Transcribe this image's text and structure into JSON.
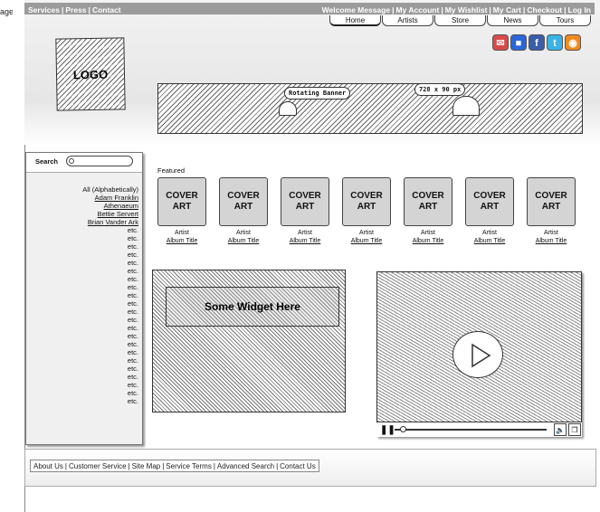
{
  "page_edge_label": "age",
  "top_nav_left": [
    "Services",
    "Press",
    "Contact"
  ],
  "top_nav_right": [
    "Welcome Message",
    "My Account",
    "My Wishlist",
    "My Cart",
    "Checkout",
    "Log In"
  ],
  "tabs": [
    "Home",
    "Artists",
    "Store",
    "News",
    "Tours"
  ],
  "social_icons": [
    "email-icon",
    "delicious-icon",
    "facebook-icon",
    "twitter-icon",
    "rss-icon"
  ],
  "logo": "LOGO",
  "banner": {
    "bubble_left": "Rotating Banner",
    "bubble_right": "728 x 90 px"
  },
  "search": {
    "label": "Search",
    "placeholder": ""
  },
  "artist_list": {
    "all": "All (Alphabetically)",
    "artists": [
      "Adam Franklin",
      "Athenaeum",
      "Bettie Servert",
      "Brian Vander Ark"
    ],
    "etc": "etc."
  },
  "featured_label": "Featured",
  "covers": [
    {
      "title": "COVER ART",
      "artist": "Artist",
      "album": "Album Title"
    },
    {
      "title": "COVER ART",
      "artist": "Artist",
      "album": "Album Title"
    },
    {
      "title": "COVER ART",
      "artist": "Artist",
      "album": "Album Title"
    },
    {
      "title": "COVER ART",
      "artist": "Artist",
      "album": "Album Title"
    },
    {
      "title": "COVER ART",
      "artist": "Artist",
      "album": "Album Title"
    },
    {
      "title": "COVER ART",
      "artist": "Artist",
      "album": "Album Title"
    },
    {
      "title": "COVER ART",
      "artist": "Artist",
      "album": "Album Title"
    }
  ],
  "widget_label": "Some Widget Here",
  "footer_links": [
    "About Us",
    "Customer Service",
    "Site Map",
    "Service Terms",
    "Advanced Search",
    "Contact Us"
  ],
  "colors": {
    "topbar": "#9b9b9b",
    "email": "#d94a4a",
    "delicious": "#2b66d9",
    "facebook": "#3b5ea8",
    "twitter": "#3ab3e6",
    "rss": "#f08a1e"
  }
}
